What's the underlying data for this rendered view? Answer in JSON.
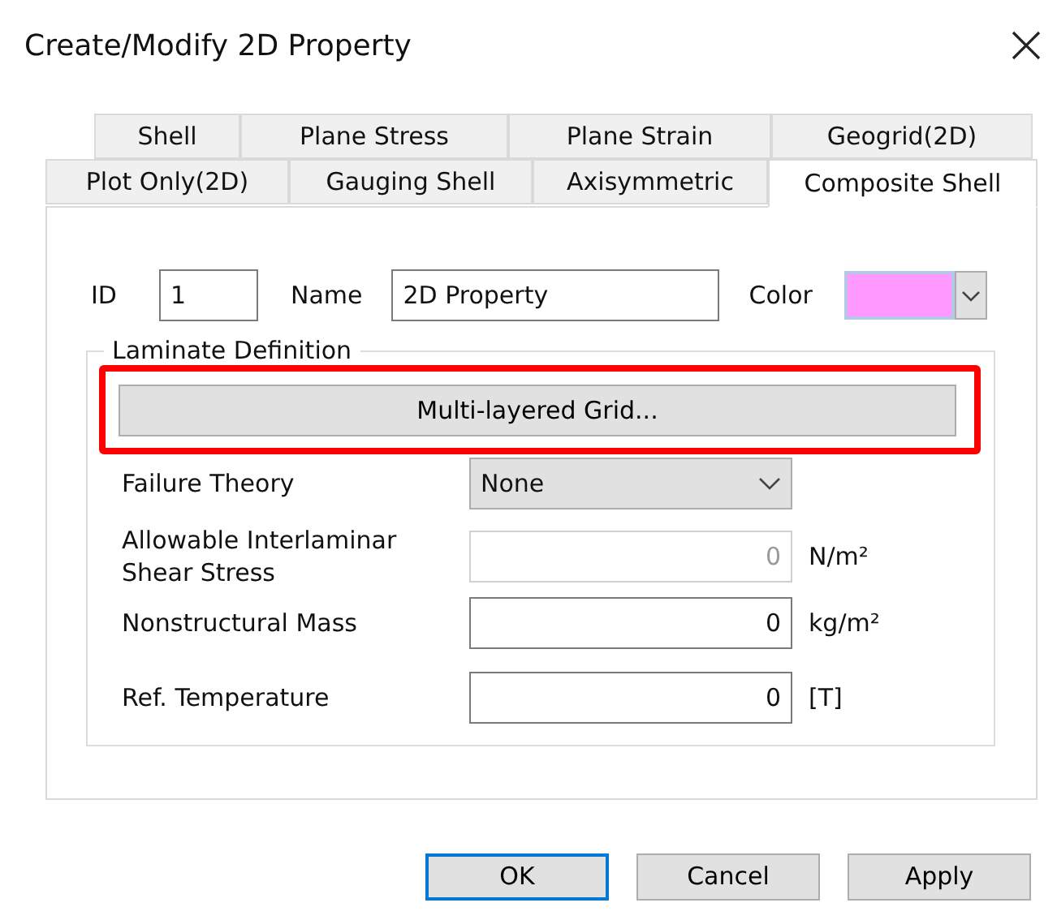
{
  "window": {
    "title": "Create/Modify 2D Property"
  },
  "tab_rows": [
    {
      "tabs": [
        {
          "label": "Shell",
          "selected": false
        },
        {
          "label": "Plane Stress",
          "selected": false
        },
        {
          "label": "Plane Strain",
          "selected": false
        },
        {
          "label": "Geogrid(2D)",
          "selected": false
        }
      ]
    },
    {
      "tabs": [
        {
          "label": "Plot Only(2D)",
          "selected": false
        },
        {
          "label": "Gauging Shell",
          "selected": false
        },
        {
          "label": "Axisymmetric",
          "selected": false
        },
        {
          "label": "Composite Shell",
          "selected": true
        }
      ]
    }
  ],
  "id_field": {
    "label": "ID",
    "value": "1"
  },
  "name_field": {
    "label": "Name",
    "value": "2D Property"
  },
  "color_field": {
    "label": "Color",
    "color": "#ff99ff"
  },
  "laminate": {
    "title": "Laminate Definition",
    "button": "Multi-layered Grid...",
    "highlighted": true,
    "rows": [
      {
        "kind": "select",
        "label": "Failure Theory",
        "value": "None",
        "disabled": false
      },
      {
        "kind": "input",
        "label": "Allowable Interlaminar Shear Stress",
        "value": "0",
        "unit": "N/m²",
        "disabled": true
      },
      {
        "kind": "input",
        "label": "Nonstructural Mass",
        "value": "0",
        "unit": "kg/m²",
        "disabled": false
      },
      {
        "kind": "input",
        "label": "Ref. Temperature",
        "value": "0",
        "unit": "[T]",
        "disabled": false
      }
    ]
  },
  "buttons": [
    {
      "label": "OK",
      "default": true
    },
    {
      "label": "Cancel",
      "default": false
    },
    {
      "label": "Apply",
      "default": false
    }
  ]
}
